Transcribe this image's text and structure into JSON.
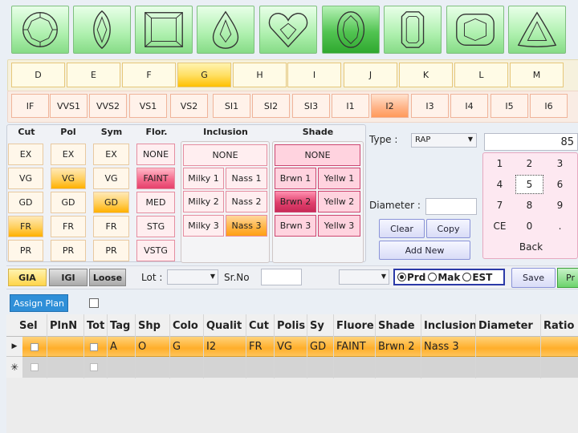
{
  "shapes": [
    {
      "name": "round",
      "selected": false
    },
    {
      "name": "marquise",
      "selected": false
    },
    {
      "name": "princess",
      "selected": false
    },
    {
      "name": "pear",
      "selected": false
    },
    {
      "name": "heart",
      "selected": false
    },
    {
      "name": "oval",
      "selected": true
    },
    {
      "name": "emerald",
      "selected": false
    },
    {
      "name": "cushion",
      "selected": false
    },
    {
      "name": "trilliant",
      "selected": false
    }
  ],
  "colors": [
    "D",
    "E",
    "F",
    "G",
    "H",
    "I",
    "J",
    "K",
    "L",
    "M"
  ],
  "selected_color": "G",
  "clarities": [
    "IF",
    "VVS1",
    "VVS2",
    "VS1",
    "VS2",
    "SI1",
    "SI2",
    "SI3",
    "I1",
    "I2",
    "I3",
    "I4",
    "I5",
    "I6"
  ],
  "selected_clarity": "I2",
  "headers": {
    "cut": "Cut",
    "pol": "Pol",
    "sym": "Sym",
    "flor": "Flor.",
    "inclusion": "Inclusion",
    "shade": "Shade"
  },
  "grades": [
    "EX",
    "VG",
    "GD",
    "FR",
    "PR"
  ],
  "cut_selected": "FR",
  "pol_selected": "VG",
  "sym_selected": "GD",
  "flor": [
    "NONE",
    "FAINT",
    "MED",
    "STG",
    "VSTG"
  ],
  "flor_selected": "FAINT",
  "inclusion": {
    "none": "NONE",
    "rows": [
      [
        "Milky 1",
        "Nass 1"
      ],
      [
        "Milky 2",
        "Nass 2"
      ],
      [
        "Milky 3",
        "Nass 3"
      ]
    ],
    "selected": "Nass 3"
  },
  "shade": {
    "none": "NONE",
    "rows": [
      [
        "Brwn 1",
        "Yellw 1"
      ],
      [
        "Brwn 2",
        "Yellw 2"
      ],
      [
        "Brwn 3",
        "Yellw 3"
      ]
    ],
    "selected": "Brwn 2"
  },
  "type": {
    "label": "Type :",
    "value": "RAP"
  },
  "diameter": {
    "label": "Diameter :",
    "value": ""
  },
  "actions": {
    "clear": "Clear",
    "copy": "Copy",
    "add_new": "Add New"
  },
  "numpad": {
    "display": "85",
    "keys": [
      "1",
      "2",
      "3",
      "4",
      "5",
      "6",
      "7",
      "8",
      "9",
      "CE",
      "0",
      "."
    ],
    "selected": "5",
    "back": "Back"
  },
  "labs": [
    "GIA",
    "IGI",
    "Loose"
  ],
  "lot": {
    "label": "Lot :",
    "value": ""
  },
  "srno": {
    "label": "Sr.No",
    "value": ""
  },
  "mode_options": [
    "Prd",
    "Mak",
    "EST"
  ],
  "mode_selected": "Prd",
  "save_label": "Save",
  "next_label": "Pr",
  "assign_plan": "Assign Plan",
  "grid": {
    "columns": [
      "Sel",
      "PlnN",
      "Tot",
      "Tag",
      "Shp",
      "Colo",
      "Qualit",
      "Cut",
      "Polis",
      "Sy",
      "Fluore",
      "Shade",
      "Inclusion",
      "Diameter",
      "Ratio"
    ],
    "rows": [
      [
        "",
        "",
        "",
        "A",
        "O",
        "G",
        "I2",
        "FR",
        "VG",
        "GD",
        "FAINT",
        "Brwn 2",
        "Nass 3",
        "",
        ""
      ]
    ]
  },
  "colors_theme": {
    "green": "#5ac85a",
    "gold": "#ffc000",
    "orange": "#ff9a5a",
    "pink": "#e5406c",
    "accent_blue": "#2f8fd8"
  }
}
